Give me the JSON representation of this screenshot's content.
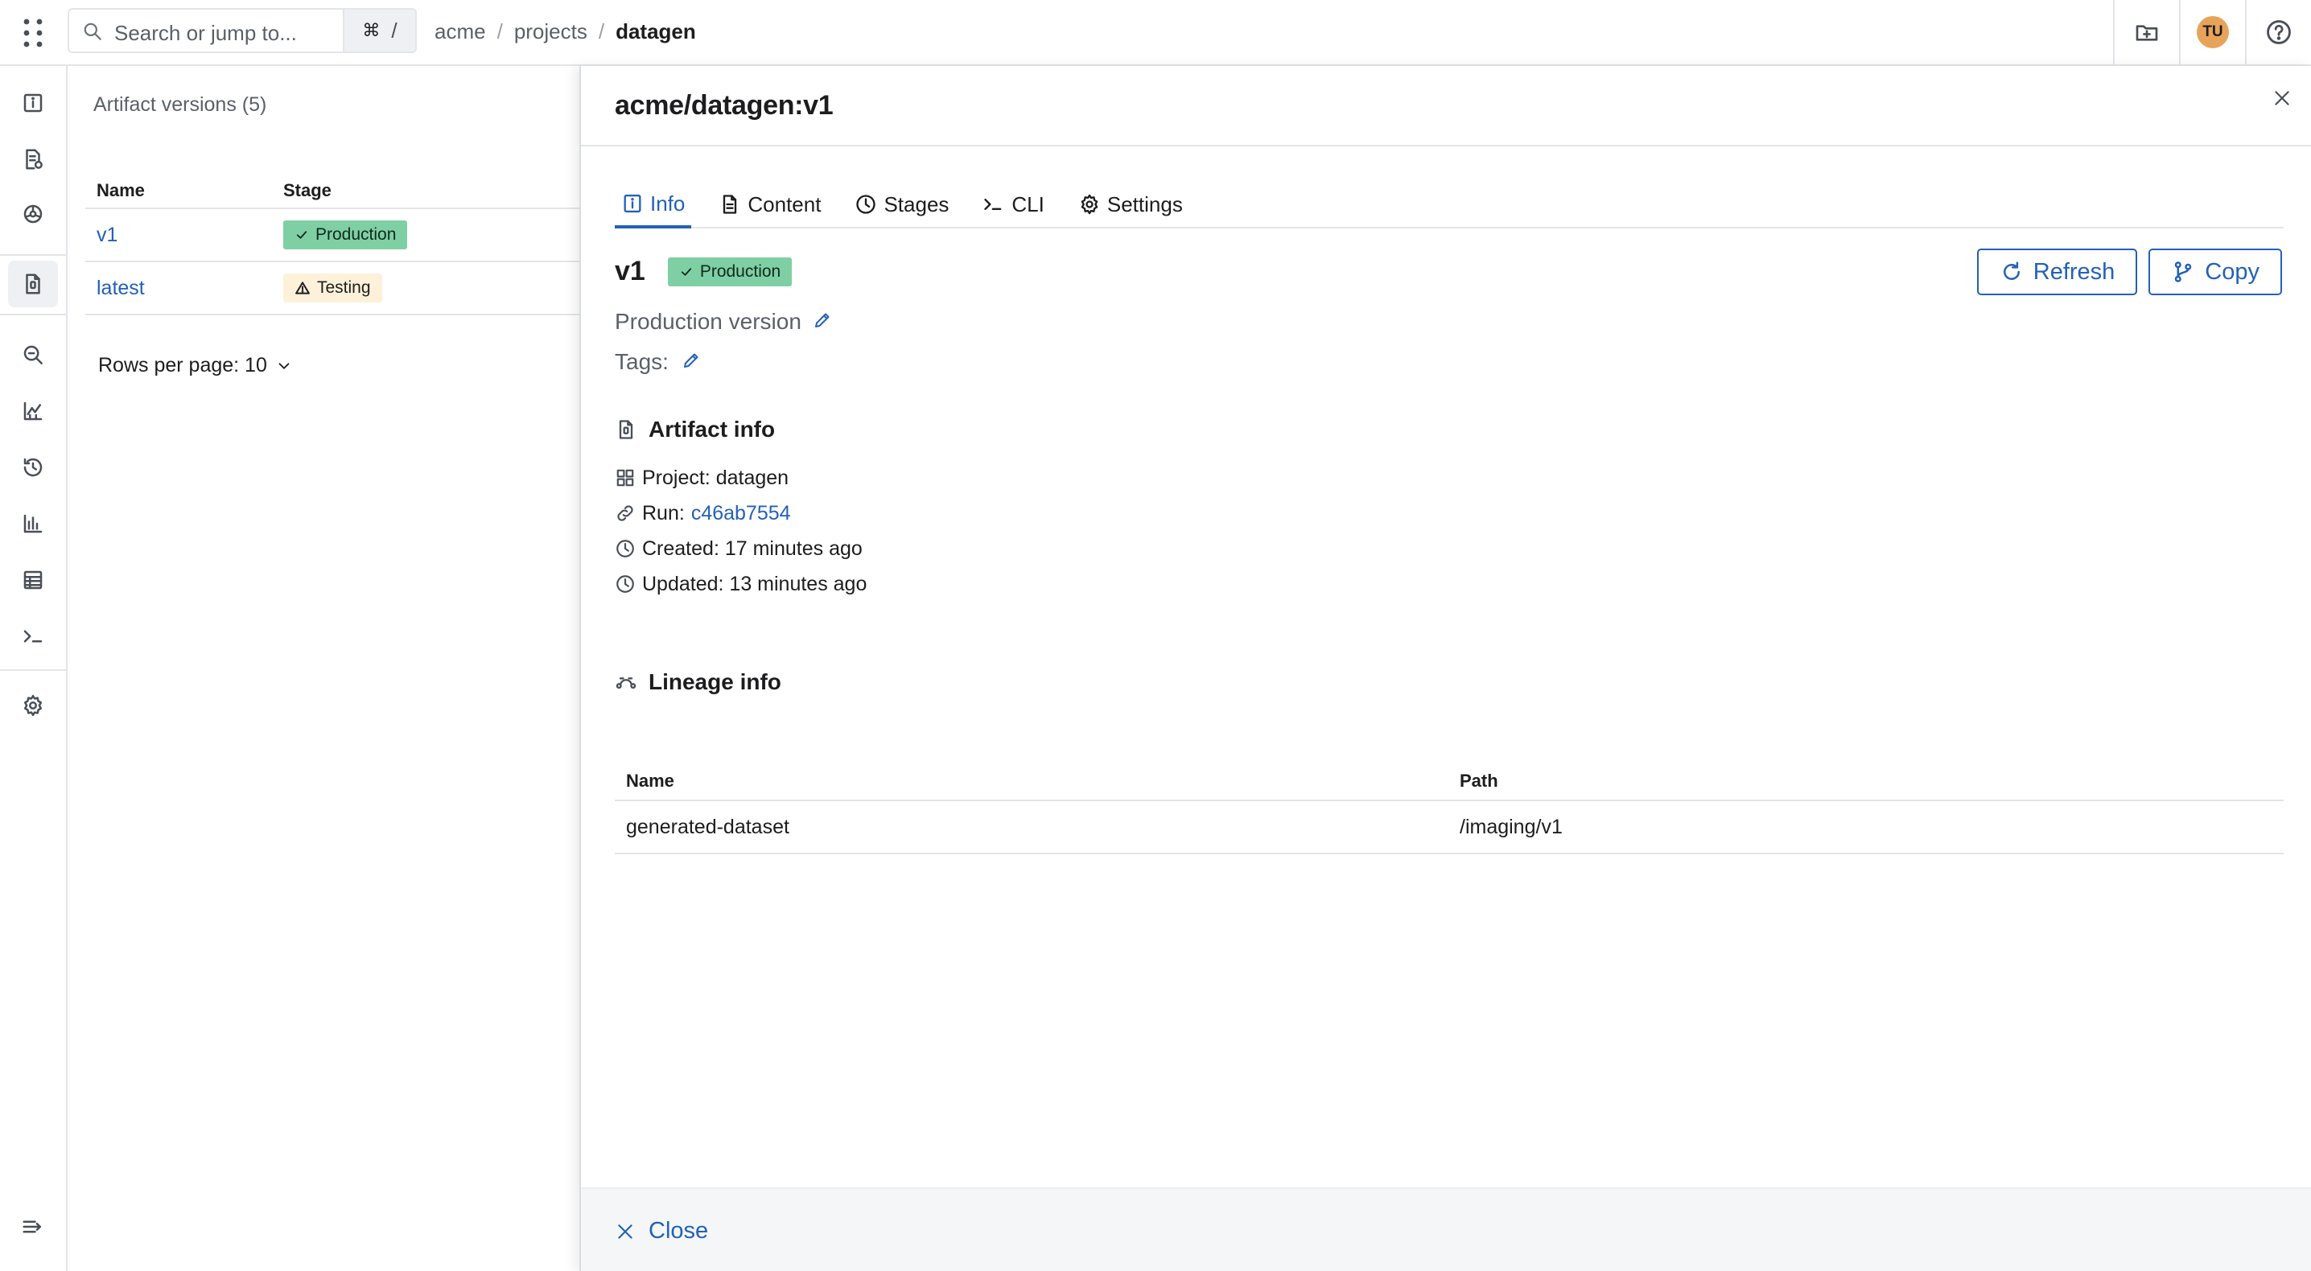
{
  "topbar": {
    "search_placeholder": "Search or jump to...",
    "shortcut_cmd": "⌘",
    "shortcut_key": "/",
    "breadcrumb": [
      "acme",
      "projects",
      "datagen"
    ],
    "avatar_initials": "TU",
    "icons": [
      "apps-grid-icon",
      "search-icon",
      "new-folder-icon",
      "help-icon"
    ]
  },
  "rail": {
    "items": [
      "info-icon",
      "report-icon",
      "models-icon",
      "artifacts-icon",
      "search-icon",
      "charts-icon",
      "history-icon",
      "bar-chart-icon",
      "table-icon",
      "terminal-icon",
      "settings-icon",
      "expand-icon"
    ],
    "active": "artifacts-icon"
  },
  "versions": {
    "title": "Artifact versions (5)",
    "columns": [
      "Name",
      "Stage"
    ],
    "rows": [
      {
        "name": "v1",
        "stage": "Production",
        "stage_kind": "production"
      },
      {
        "name": "latest",
        "stage": "Testing",
        "stage_kind": "testing"
      }
    ],
    "rows_per_page": "Rows per page: 10"
  },
  "drawer": {
    "title": "acme/datagen:v1",
    "tabs": [
      {
        "label": "Info",
        "icon": "info-icon",
        "active": true
      },
      {
        "label": "Content",
        "icon": "document-icon",
        "active": false
      },
      {
        "label": "Stages",
        "icon": "clock-icon",
        "active": false
      },
      {
        "label": "CLI",
        "icon": "terminal-icon",
        "active": false
      },
      {
        "label": "Settings",
        "icon": "gear-icon",
        "active": false
      }
    ],
    "version": "v1",
    "stage_badge": "Production",
    "buttons": {
      "refresh": "Refresh",
      "copy": "Copy"
    },
    "description": "Production version",
    "tags_label": "Tags:",
    "artifact_info": {
      "title": "Artifact info",
      "project": "Project: datagen",
      "run_label": "Run:",
      "run_id": "c46ab7554",
      "created": "Created: 17 minutes ago",
      "updated": "Updated: 13 minutes ago"
    },
    "lineage": {
      "title": "Lineage info",
      "columns": [
        "Name",
        "Path"
      ],
      "rows": [
        {
          "name": "generated-dataset",
          "path": "/imaging/v1"
        }
      ]
    },
    "footer_close": "Close"
  },
  "colors": {
    "accent": "#2361b8",
    "production_badge": "#7fcfa4",
    "testing_badge": "#fdf1da",
    "avatar": "#e8a35a"
  }
}
